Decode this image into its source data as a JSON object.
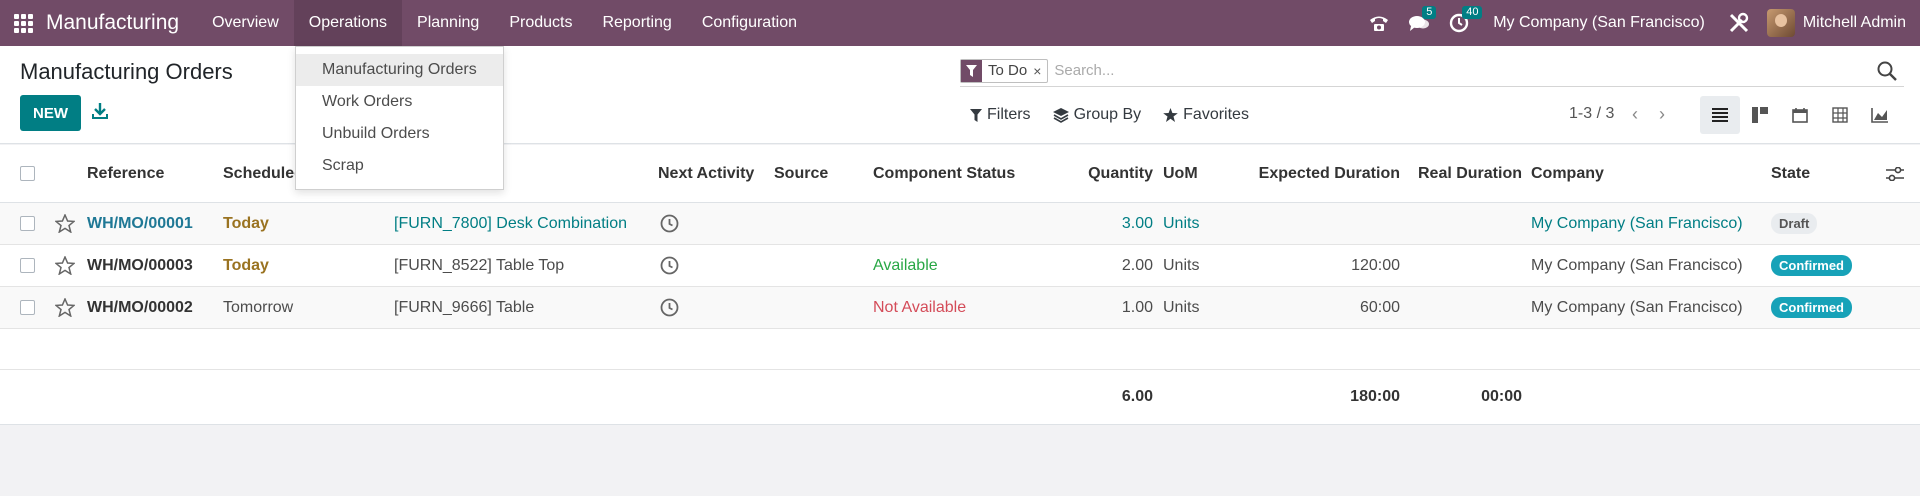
{
  "navbar": {
    "brand": "Manufacturing",
    "menus": [
      "Overview",
      "Operations",
      "Planning",
      "Products",
      "Reporting",
      "Configuration"
    ],
    "active_menu": "Operations",
    "messages_badge": "5",
    "activities_badge": "40",
    "company": "My Company (San Francisco)",
    "user": "Mitchell Admin"
  },
  "control_panel": {
    "title": "Manufacturing Orders",
    "new_label": "NEW",
    "search_facet": "To Do",
    "search_facet_close": "×",
    "search_placeholder": "Search...",
    "filters_label": "Filters",
    "group_by_label": "Group By",
    "favorites_label": "Favorites",
    "pager": "1-3 / 3"
  },
  "dropdown": {
    "items": [
      "Manufacturing Orders",
      "Work Orders",
      "Unbuild Orders",
      "Scrap"
    ],
    "hovered": "Manufacturing Orders"
  },
  "table": {
    "columns": [
      "Reference",
      "Scheduled",
      "Next Activity",
      "Source",
      "Component Status",
      "Quantity",
      "UoM",
      "Expected Duration",
      "Real Duration",
      "Company",
      "State"
    ],
    "rows": [
      {
        "reference": "WH/MO/00001",
        "scheduled": "Today",
        "product": "[FURN_7800] Desk Combination",
        "component_status": "",
        "quantity": "3.00",
        "uom": "Units",
        "expected": "",
        "real": "",
        "company": "My Company (San Francisco)",
        "state": "Draft"
      },
      {
        "reference": "WH/MO/00003",
        "scheduled": "Today",
        "product": "[FURN_8522] Table Top",
        "component_status": "Available",
        "quantity": "2.00",
        "uom": "Units",
        "expected": "120:00",
        "real": "",
        "company": "My Company (San Francisco)",
        "state": "Confirmed"
      },
      {
        "reference": "WH/MO/00002",
        "scheduled": "Tomorrow",
        "product": "[FURN_9666] Table",
        "component_status": "Not Available",
        "quantity": "1.00",
        "uom": "Units",
        "expected": "60:00",
        "real": "",
        "company": "My Company (San Francisco)",
        "state": "Confirmed"
      }
    ],
    "totals": {
      "quantity": "6.00",
      "expected": "180:00",
      "real": "00:00"
    }
  },
  "colors": {
    "brand": "#714b67",
    "primary": "#017e84",
    "link": "#1f7895",
    "warning": "#9a7321",
    "success": "#28a745",
    "danger": "#d44c59",
    "info": "#17a2b8"
  }
}
